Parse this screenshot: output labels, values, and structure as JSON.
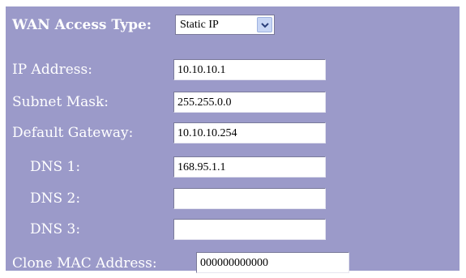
{
  "wan": {
    "label": "WAN Access Type:",
    "selected": "Static IP"
  },
  "fields": {
    "ip_label": "IP Address:",
    "ip_value": "10.10.10.1",
    "subnet_label": "Subnet Mask:",
    "subnet_value": "255.255.0.0",
    "gateway_label": "Default Gateway:",
    "gateway_value": "10.10.10.254",
    "dns1_label": "DNS 1:",
    "dns1_value": "168.95.1.1",
    "dns2_label": "DNS 2:",
    "dns2_value": "",
    "dns3_label": "DNS 3:",
    "dns3_value": "",
    "mac_label": "Clone MAC Address:",
    "mac_value": "000000000000"
  },
  "icons": {
    "dropdown": "chevron-down-icon"
  },
  "colors": {
    "panel_background": "#9b9ac9",
    "label_text": "#ffffff"
  }
}
